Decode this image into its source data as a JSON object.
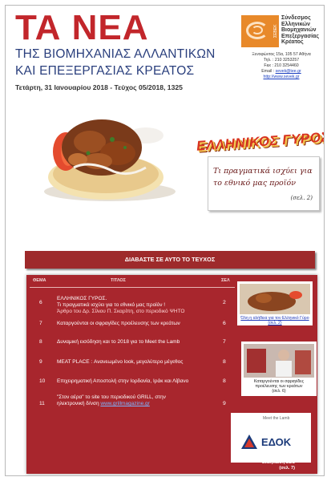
{
  "masthead": {
    "title": "ΤΑ ΝΕΑ",
    "subtitle_line1": "ΤΗΣ ΒΙΟΜΗΧΑΝΙΑΣ ΑΛΛΑΝΤΙΚΩΝ",
    "subtitle_line2": "ΚΑΙ ΕΠΕΞΕΡΓΑΣΙΑΣ ΚΡΕΑΤΟΣ",
    "dateline": "Τετάρτη, 31 Ιανουαρίου 2018 - Τεύχος 05/2018, 1325"
  },
  "org": {
    "acronym": "ΣΕΒΕΚ",
    "name_lines": [
      "Σύνδεσμος",
      "Ελληνικών",
      "Βιομηχανιών",
      "Επεξεργασίας",
      "Κρέατος"
    ],
    "address": "Ξενοφώντος 15α, 105 57 Αθήνα",
    "phone": "Τηλ. : 210 3253257",
    "fax": "Fax : 210 3254460",
    "email_label": "Email :",
    "email": "sevek@tee.gr",
    "website": "http://www.sevek.gr"
  },
  "cover_story": {
    "headline": "ΕΛΛΗΝΙΚΟΣ ΓΥΡΟΣ",
    "quote_line1": "Τι πραγματικά ισχύει για",
    "quote_line2": "το εθνικό μας προϊόν",
    "ref": "(σελ. 2)"
  },
  "read_in_issue": "ΔΙΑΒΑΣΤΕ ΣΕ ΑΥΤΟ ΤΟ ΤΕΥΧΟΣ",
  "toc": {
    "headers": {
      "num": "ΘΕΜΑ",
      "title": "ΤΙΤΛΟΣ",
      "page": "ΣΕΛ"
    },
    "rows": [
      {
        "num": "6",
        "title": "ΕΛΛΗΝΙΚΟΣ ΓΥΡΟΣ.",
        "title2": "Τι πραγματικά ισχύει για το εθνικό μας προϊόν !",
        "sub": "Άρθρο του Δρ. Σίλιου Π. Σκαρίπη, στο περιοδικό ΨΗΤΟ",
        "page": "2"
      },
      {
        "num": "7",
        "title": "Καταργούνται οι σφραγίδες προέλευσης των κρεάτων",
        "page": "6"
      },
      {
        "num": "8",
        "title": "Δυναμική εισόδηση και το 2018 για το Meet the Lamb",
        "page": "7"
      },
      {
        "num": "9",
        "title": "MEAT PLACE : Ανανεωμένο look, μεγαλύτερο μέγεθος",
        "page": "8"
      },
      {
        "num": "10",
        "title": "Επιχειρηματική Αποστολή στην Ιορδανία, Ιράκ και Λίβανο",
        "page": "8"
      },
      {
        "num": "11",
        "title": "\"Στον αέρα\" το site του περιοδικού GRILL, στην",
        "title2": "ηλεκτρονική δ/νση",
        "link": "www.grillmagazine.gr",
        "page": "9"
      }
    ]
  },
  "side": {
    "cap1": "Όλη η αλήθεια για τον Ελληνικό Γύρο (σελ. 2)",
    "cap2_line1": "Καταργούνται οι σφραγίδες",
    "cap2_line2": "προέλευσης των κρεάτων",
    "cap2_ref": "(σελ. 6)",
    "meet_label": "Meet the Lamb",
    "edok": "ΕΔΟΚ",
    "edok_sub": "Εκδήλωση 21/2",
    "edok_ref": "(σελ. 7)"
  },
  "colors": {
    "brand_red": "#c2262b",
    "navy": "#2a3f7d",
    "toc_bg": "#a8262d",
    "bar_bg": "#9e2a2b",
    "logo_orange": "#e8892a"
  }
}
